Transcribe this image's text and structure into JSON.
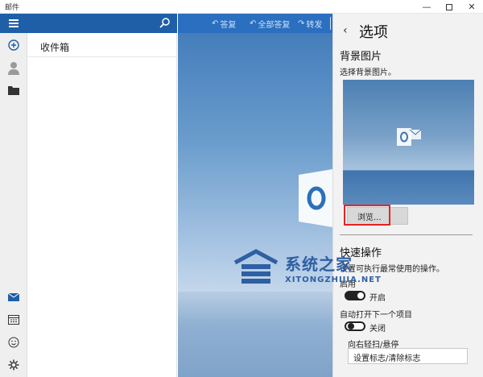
{
  "window": {
    "title": "邮件"
  },
  "rail": {
    "icons": [
      "hamburger-menu-icon",
      "new-mail-icon",
      "account-icon",
      "folder-icon",
      "mail-icon",
      "calendar-icon",
      "feedback-smiley-icon",
      "settings-gear-icon"
    ]
  },
  "folder_pane": {
    "title": "收件箱"
  },
  "toolbar": {
    "reply": "答复",
    "reply_all": "全部答复",
    "forward": "转发"
  },
  "options": {
    "title": "选项",
    "background_section": "背景图片",
    "background_hint": "选择背景图片。",
    "browse_button": "浏览...",
    "quick_actions_section": "快速操作",
    "quick_actions_desc": "设置可执行最常使用的操作。",
    "toggle1_label": "启用",
    "toggle1_value": "开启",
    "toggle1_on": true,
    "auto_open_label": "自动打开下一个项目",
    "toggle2_value": "关闭",
    "toggle2_on": false,
    "swipe_label": "向右轻扫/悬停",
    "swipe_value": "设置标志/清除标志"
  },
  "watermark": {
    "text": "系统之家",
    "sub": "XITONGZHIJIA.NET"
  },
  "colors": {
    "accent": "#1f5fa8",
    "toolbar": "#2a6fc0",
    "highlight": "#e8231f"
  }
}
